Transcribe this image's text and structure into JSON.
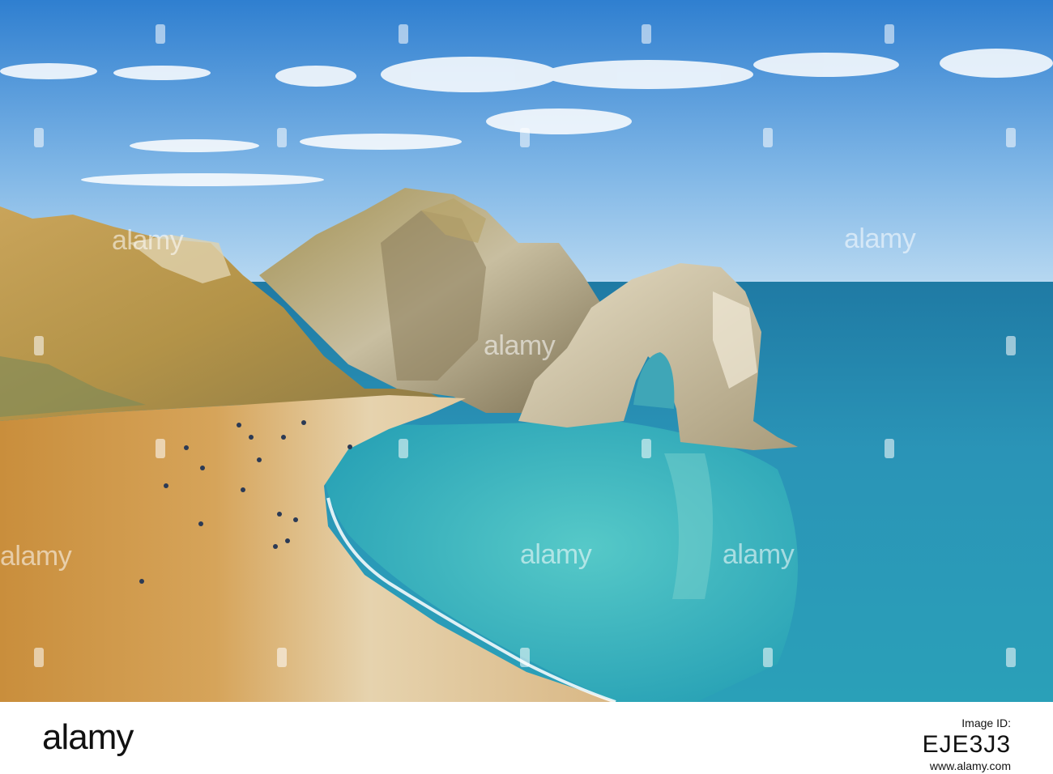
{
  "image": {
    "subject": "coastal-arch-beach",
    "watermark_word": "alamy",
    "colors": {
      "sky_top": "#3f8ad6",
      "sky_bottom": "#a9cfee",
      "sea_deep": "#2a8fb1",
      "sea_shallow": "#3fbfc4",
      "sand_warm": "#d19a4a",
      "sand_pale": "#e7d7b8",
      "cliff_light": "#d9cfb6",
      "cliff_shadow": "#8b7e5a",
      "grass": "#9a8a3e"
    }
  },
  "footer": {
    "logo": "alamy",
    "image_id_label": "Image ID:",
    "image_id": "EJE3J3",
    "site": "www.alamy.com"
  }
}
